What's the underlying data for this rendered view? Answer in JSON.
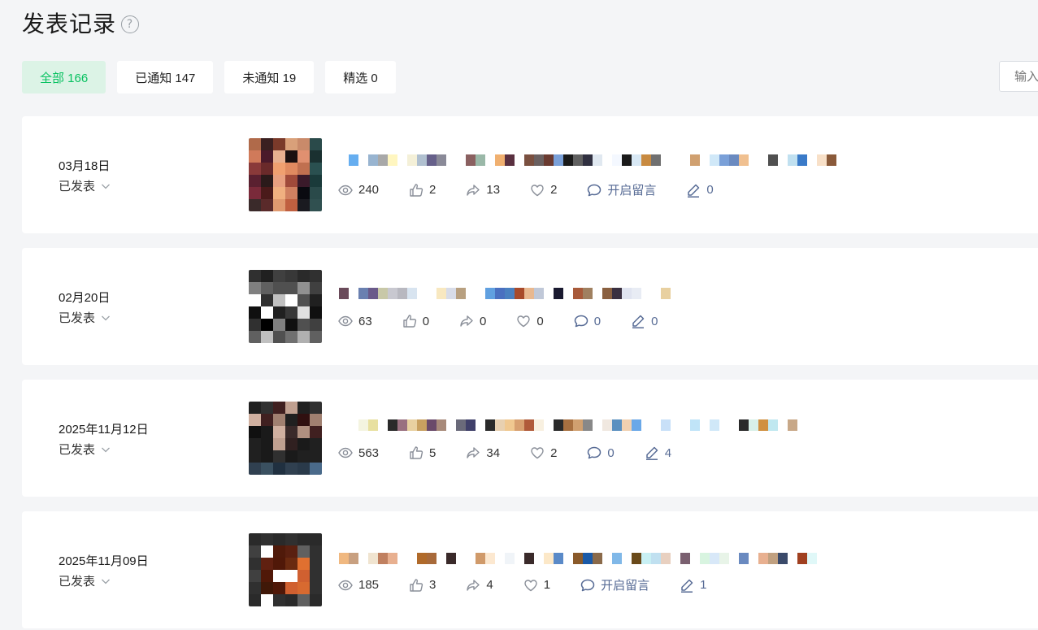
{
  "header": {
    "title": "发表记录",
    "help_glyph": "?"
  },
  "filters": [
    {
      "label": "全部 166",
      "active": true
    },
    {
      "label": "已通知 147",
      "active": false
    },
    {
      "label": "未通知 19",
      "active": false
    },
    {
      "label": "精选 0",
      "active": false
    }
  ],
  "search": {
    "placeholder": "输入"
  },
  "colors": {
    "accent": "#07c160",
    "accent_bg": "#dcf3e6",
    "link": "#576b95"
  },
  "posts": [
    {
      "date": "03月18日",
      "status": "已发表",
      "stats": {
        "views": "240",
        "likes": "2",
        "shares": "13",
        "favorites": "2",
        "comments": "开启留言",
        "notes": "0"
      },
      "thumb_colors": [
        "#b06a4a",
        "#3a2020",
        "#7a3a2a",
        "#d9a07a",
        "#c98a6a",
        "#2a4a4a",
        "#d07a5a",
        "#4a1a2a",
        "#e8b090",
        "#1a1010",
        "#e09070",
        "#1a3030",
        "#8a3a3a",
        "#6a2a2a",
        "#f0a070",
        "#e08a60",
        "#c07050",
        "#2a5050",
        "#5a2030",
        "#2a1a1a",
        "#e8a080",
        "#a04a3a",
        "#3a1a2a",
        "#1a3a3a",
        "#7a2a3a",
        "#4a1a1a",
        "#f0b080",
        "#d08060",
        "#0a0a10",
        "#2a4a4a",
        "#3a2a2a",
        "#5a2a2a",
        "#e09a70",
        "#c06040",
        "#1a1a20",
        "#305050"
      ],
      "title_colors": [
        "#ffffff",
        "#66aef0",
        "#ffffff",
        "#98b4d0",
        "#a8a8a8",
        "#fff6c0",
        "#ffffff",
        "#f4f0d8",
        "#b0c0d0",
        "#66608a",
        "#8a8a98",
        "#ffffff",
        "#ffffff",
        "#8a6060",
        "#9ab8a8",
        "#ffffff",
        "#f0b070",
        "#5a3040",
        "#ffffff",
        "#7a5040",
        "#6a6060",
        "#6a3a30",
        "#7aa0d8",
        "#1a1a1a",
        "#606060",
        "#303040",
        "#e0e8f0",
        "#ffffff",
        "#f4f8ff",
        "#1a1a1a",
        "#d8e8f4",
        "#c88a40",
        "#707070",
        "#ffffff",
        "#ffffff",
        "#ffffff",
        "#d0a070",
        "#ffffff",
        "#d0e8f8",
        "#7aa0d8",
        "#6a8ac0",
        "#f0c090",
        "#ffffff",
        "#ffffff",
        "#505050",
        "#ffffff",
        "#c0e0f0",
        "#3a7ac8",
        "#ffffff",
        "#f8e0c8",
        "#8a5a3a"
      ]
    },
    {
      "date": "02月20日",
      "status": "已发表",
      "stats": {
        "views": "63",
        "likes": "0",
        "shares": "0",
        "favorites": "0",
        "comments": "0",
        "notes": "0"
      },
      "thumb_colors": [
        "#303030",
        "#202020",
        "#404040",
        "#383838",
        "#2a2a2a",
        "#303030",
        "#808080",
        "#606060",
        "#505050",
        "#505050",
        "#909090",
        "#404040",
        "#ffffff",
        "#303030",
        "#c0c0c0",
        "#ffffff",
        "#505050",
        "#202020",
        "#101010",
        "#ffffff",
        "#202020",
        "#383838",
        "#e0e0e0",
        "#101010",
        "#303030",
        "#000000",
        "#808080",
        "#101010",
        "#505050",
        "#404040",
        "#606060",
        "#c0c0c0",
        "#505050",
        "#707070",
        "#b0b0b0",
        "#606060"
      ],
      "title_colors": [
        "#6a4a5a",
        "#ffffff",
        "#6a80b0",
        "#6a5a8a",
        "#c8c8a8",
        "#c8c8d0",
        "#b8b8c0",
        "#d8e4f0",
        "#ffffff",
        "#ffffff",
        "#f8e8c0",
        "#d8dce8",
        "#b8a080",
        "#ffffff",
        "#ffffff",
        "#60a0e0",
        "#4a70c0",
        "#4a80c0",
        "#a84a2a",
        "#e8b890",
        "#c0c8d8",
        "#ffffff",
        "#1a1a30",
        "#ffffff",
        "#a85a3a",
        "#a08060",
        "#ffffff",
        "#8a6040",
        "#3a3040",
        "#e0e4f0",
        "#e8ecf4",
        "#ffffff",
        "#ffffff",
        "#e8d0a0"
      ]
    },
    {
      "date": "2025年11月12日",
      "status": "已发表",
      "stats": {
        "views": "563",
        "likes": "5",
        "shares": "34",
        "favorites": "2",
        "comments": "0",
        "notes": "4"
      },
      "thumb_colors": [
        "#202020",
        "#303030",
        "#402020",
        "#c0a090",
        "#202020",
        "#303030",
        "#d0b0a0",
        "#402020",
        "#a08070",
        "#202020",
        "#301010",
        "#a08070",
        "#101010",
        "#1a1a1a",
        "#d0b0a0",
        "#3a2a2a",
        "#b09080",
        "#402020",
        "#202020",
        "#1a1a1a",
        "#c0a090",
        "#302020",
        "#1a1a1a",
        "#202020",
        "#202020",
        "#1a1a1a",
        "#303030",
        "#1a1a1a",
        "#202020",
        "#202020",
        "#304050",
        "#3a5060",
        "#203040",
        "#304050",
        "#2a3a4a",
        "#4a6a8a"
      ],
      "title_colors": [
        "#ffffff",
        "#ffffff",
        "#f4f4e0",
        "#e8e0a0",
        "#ffffff",
        "#2a2a2a",
        "#9a7080",
        "#e8d0a0",
        "#c8a060",
        "#6a4a6a",
        "#a88a7a",
        "#ffffff",
        "#6a6a7a",
        "#40406a",
        "#ffffff",
        "#2a2a2a",
        "#e8d0b0",
        "#f0c890",
        "#d8a070",
        "#b05a3a",
        "#f8f0e0",
        "#ffffff",
        "#2a2a2a",
        "#a87040",
        "#d0a070",
        "#888888",
        "#ffffff",
        "#f0e8e0",
        "#5a90c0",
        "#f0d0b0",
        "#6aa8e8",
        "#ffffff",
        "#ffffff",
        "#c8e0f8",
        "#ffffff",
        "#ffffff",
        "#c0e4f8",
        "#ffffff",
        "#d0e8f8",
        "#ffffff",
        "#ffffff",
        "#2a2a2a",
        "#d8f0e8",
        "#d09040",
        "#c0e8f0",
        "#ffffff",
        "#c8a888"
      ]
    },
    {
      "date": "2025年11月09日",
      "status": "已发表",
      "stats": {
        "views": "185",
        "likes": "3",
        "shares": "4",
        "favorites": "1",
        "comments": "开启留言",
        "notes": "1"
      },
      "thumb_colors": [
        "#2a2a2a",
        "#303030",
        "#2a2a2a",
        "#303030",
        "#2a2a2a",
        "#2a2a2a",
        "#404040",
        "#ffffff",
        "#501a0a",
        "#5a2010",
        "#606060",
        "#303030",
        "#303030",
        "#602010",
        "#501808",
        "#6a2a10",
        "#e07030",
        "#303030",
        "#404040",
        "#501808",
        "#ffffff",
        "#ffffff",
        "#d06030",
        "#303030",
        "#303030",
        "#401808",
        "#501808",
        "#d06030",
        "#d86a30",
        "#303030",
        "#2a2a2a",
        "#ffffff",
        "#303030",
        "#2a2a2a",
        "#606060",
        "#2a2a2a"
      ],
      "title_colors": [
        "#f0b880",
        "#c8a080",
        "#ffffff",
        "#f0e4d0",
        "#c08060",
        "#e8b090",
        "#ffffff",
        "#ffffff",
        "#b06a2a",
        "#a86a3a",
        "#ffffff",
        "#3a2a2a",
        "#ffffff",
        "#ffffff",
        "#d09a6a",
        "#fce8d0",
        "#ffffff",
        "#f0f4f8",
        "#ffffff",
        "#3a2a2a",
        "#ffffff",
        "#fce8c8",
        "#5a8ac8",
        "#ffffff",
        "#8a5a2a",
        "#1a5aa8",
        "#8a6a4a",
        "#ffffff",
        "#80b8e8",
        "#ffffff",
        "#6a4a1a",
        "#c8f0f4",
        "#c0e0f0",
        "#e8d0c0",
        "#ffffff",
        "#7a6070",
        "#ffffff",
        "#d8f4e0",
        "#d8e8f8",
        "#e8f4e8",
        "#ffffff",
        "#6a8ac0",
        "#ffffff",
        "#e8b090",
        "#c0a080",
        "#3a4a6a",
        "#ffffff",
        "#a04020",
        "#e0f8f8"
      ]
    }
  ]
}
